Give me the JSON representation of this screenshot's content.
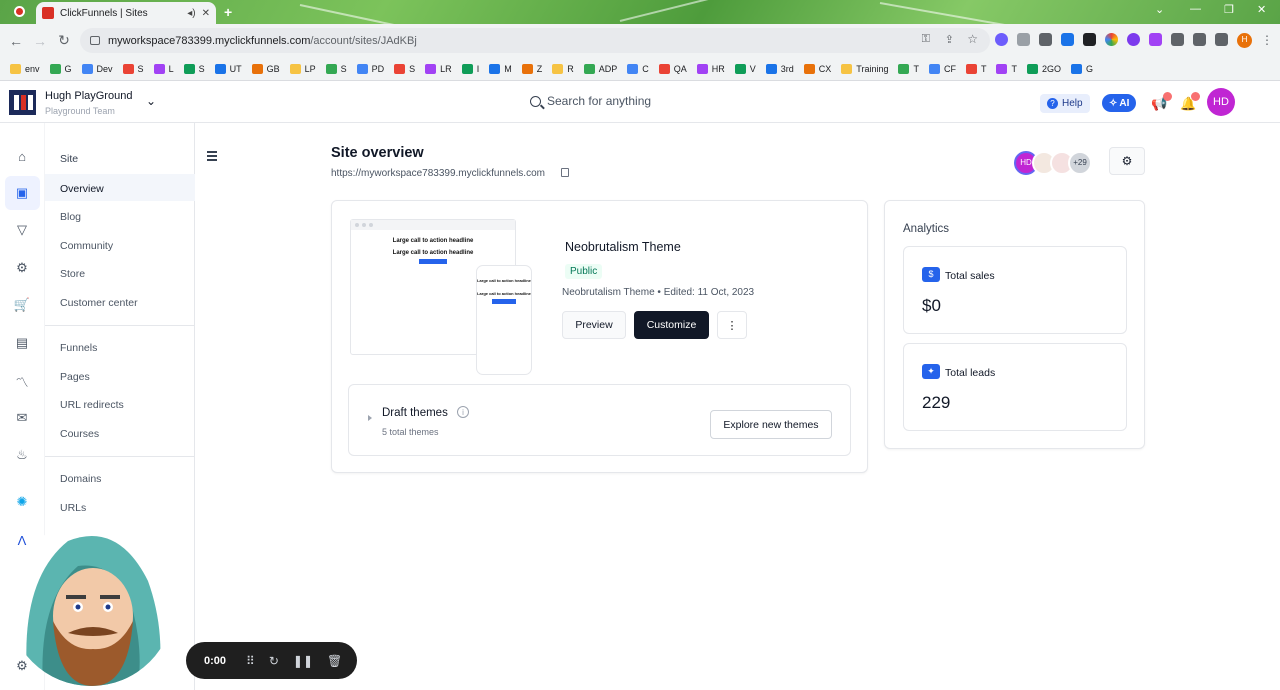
{
  "browser": {
    "tab_title": "ClickFunnels | Sites",
    "url_host": "myworkspace783399.myclickfunnels.com",
    "url_path": "/account/sites/JAdKBj",
    "profile_initial": "H",
    "bookmarks": [
      "env",
      "G",
      "Dev",
      "S",
      "L",
      "S",
      "UT",
      "GB",
      "LP",
      "S",
      "PD",
      "S",
      "LR",
      "I",
      "M",
      "Z",
      "R",
      "ADP",
      "C",
      "QA",
      "HR",
      "V",
      "3rd",
      "CX",
      "Training",
      "T",
      "CF",
      "T",
      "T",
      "2GO",
      "G"
    ]
  },
  "header": {
    "workspace_name": "Hugh PlayGround",
    "workspace_team": "Playground Team",
    "search_placeholder": "Search for anything",
    "help_label": "Help",
    "ai_label": "AI",
    "avatar_initials": "HD"
  },
  "sidebar": {
    "site_header": "Site",
    "site_items": [
      "Overview",
      "Blog",
      "Community",
      "Store",
      "Customer center"
    ],
    "funnel_items": [
      "Funnels",
      "Pages",
      "URL redirects",
      "Courses"
    ],
    "domain_items": [
      "Domains",
      "URLs"
    ]
  },
  "page": {
    "title": "Site overview",
    "site_url": "https://myworkspace783399.myclickfunnels.com",
    "members": {
      "first_initials": "HD",
      "more_count": "+29"
    }
  },
  "theme": {
    "preview_headline": "Large call to action headline",
    "preview_button": "Click to Sign Up",
    "name": "Neobrutalism Theme",
    "status": "Public",
    "meta": "Neobrutalism Theme • Edited: 11 Oct, 2023",
    "preview_label": "Preview",
    "customize_label": "Customize",
    "more_label": "⋮"
  },
  "drafts": {
    "title": "Draft themes",
    "count_text": "5 total themes",
    "explore_label": "Explore new themes"
  },
  "analytics": {
    "title": "Analytics",
    "sales_label": "Total sales",
    "sales_value": "$0",
    "leads_label": "Total leads",
    "leads_value": "229"
  },
  "recorder": {
    "time": "0:00"
  },
  "colors": {
    "accent": "#2563eb",
    "dark_button": "#111827",
    "avatar": "#c026d3",
    "public_badge_bg": "#ecfdf5"
  }
}
